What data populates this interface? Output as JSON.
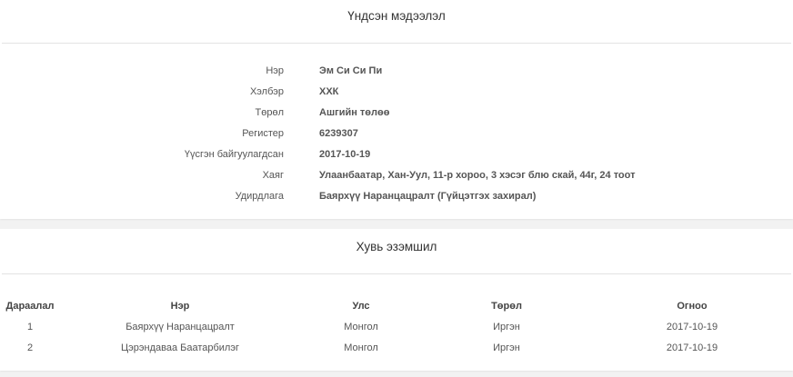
{
  "basic_info": {
    "title": "Үндсэн мэдээлэл",
    "rows": [
      {
        "label": "Нэр",
        "value": "Эм Си Си Пи"
      },
      {
        "label": "Хэлбэр",
        "value": "ХХК"
      },
      {
        "label": "Төрөл",
        "value": "Ашгийн төлөө"
      },
      {
        "label": "Регистер",
        "value": "6239307"
      },
      {
        "label": "Үүсгэн байгуулагдсан",
        "value": "2017-10-19"
      },
      {
        "label": "Хаяг",
        "value": "Улаанбаатар, Хан-Уул, 11-р хороо, 3 хэсэг блю скай, 44г, 24 тоот"
      },
      {
        "label": "Удирдлага",
        "value": "Баярхүү Наранцацралт (Гүйцэтгэх захирал)"
      }
    ]
  },
  "ownership": {
    "title": "Хувь эзэмшил",
    "columns": [
      "Дараалал",
      "Нэр",
      "Улс",
      "Төрөл",
      "Огноо"
    ],
    "rows": [
      [
        "1",
        "Баярхүү Наранцацралт",
        "Монгол",
        "Иргэн",
        "2017-10-19"
      ],
      [
        "2",
        "Цэрэндаваа Баатарбилэг",
        "Монгол",
        "Иргэн",
        "2017-10-19"
      ]
    ]
  }
}
